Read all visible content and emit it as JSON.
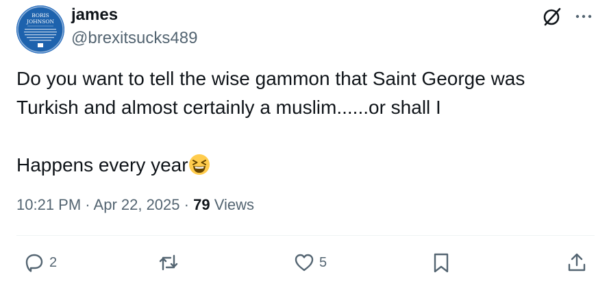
{
  "author": {
    "display_name": "james",
    "handle": "@brexitsucks489",
    "avatar_plaque_title_line1": "BORIS",
    "avatar_plaque_title_line2": "JOHNSON"
  },
  "tweet": {
    "text_line1": "Do you want to tell the wise gammon that Saint George was",
    "text_line2": "Turkish and almost certainly a muslim......or shall I",
    "text_line3": "Happens every year",
    "emoji": "grinning-squinting-face",
    "time": "10:21 PM",
    "separator": "·",
    "date": "Apr 22, 2025",
    "views_count": "79",
    "views_label": "Views"
  },
  "actions": {
    "reply_count": "2",
    "like_count": "5"
  },
  "colors": {
    "text": "#0f1419",
    "secondary": "#536471",
    "divider": "#eff3f4",
    "avatar_blue": "#1c5fa8"
  }
}
